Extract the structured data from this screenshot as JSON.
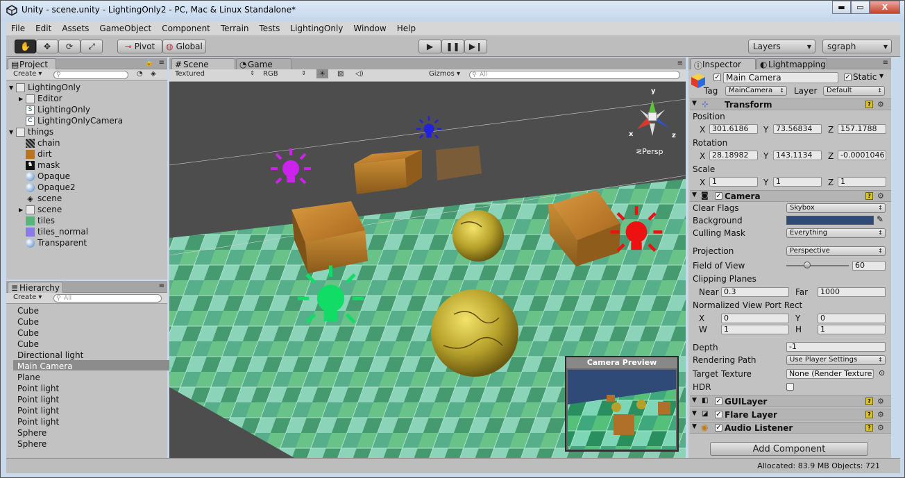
{
  "window": {
    "title": "Unity - scene.unity - LightingOnly2 - PC, Mac & Linux Standalone*",
    "minimize": "▬",
    "maximize": "▭",
    "close": "X"
  },
  "menu": [
    "File",
    "Edit",
    "Assets",
    "GameObject",
    "Component",
    "Terrain",
    "Tests",
    "LightingOnly",
    "Window",
    "Help"
  ],
  "toolbar": {
    "pivot": "Pivot",
    "global": "Global",
    "layers": "Layers",
    "layout": "sgraph"
  },
  "project": {
    "tab": "Project",
    "create": "Create",
    "items": [
      {
        "label": "LightingOnly",
        "icon": "folder-icon"
      },
      {
        "label": "Editor",
        "icon": "folder-icon"
      },
      {
        "label": "LightingOnly",
        "icon": "script-icon"
      },
      {
        "label": "LightingOnlyCamera",
        "icon": "script-icon"
      },
      {
        "label": "things",
        "icon": "folder-icon"
      },
      {
        "label": "chain",
        "icon": "texture-icon"
      },
      {
        "label": "dirt",
        "icon": "texture-icon"
      },
      {
        "label": "mask",
        "icon": "texture-icon"
      },
      {
        "label": "Opaque",
        "icon": "material-icon"
      },
      {
        "label": "Opaque2",
        "icon": "material-icon"
      },
      {
        "label": "scene",
        "icon": "unity-scene-icon"
      },
      {
        "label": "scene",
        "icon": "folder-icon"
      },
      {
        "label": "tiles",
        "icon": "texture-icon"
      },
      {
        "label": "tiles_normal",
        "icon": "texture-icon"
      },
      {
        "label": "Transparent",
        "icon": "material-icon"
      }
    ]
  },
  "hierarchy": {
    "tab": "Hierarchy",
    "create": "Create",
    "search_placeholder": "All",
    "items": [
      "Cube",
      "Cube",
      "Cube",
      "Cube",
      "Directional light",
      "Main Camera",
      "Plane",
      "Point light",
      "Point light",
      "Point light",
      "Point light",
      "Sphere",
      "Sphere"
    ],
    "selected": "Main Camera"
  },
  "scene": {
    "tabs": [
      "Scene",
      "Game"
    ],
    "draw_mode": "Textured",
    "channel": "RGB",
    "gizmos": "Gizmos",
    "search_placeholder": "All",
    "persp_label": "Persp",
    "axis_x": "x",
    "axis_y": "y",
    "axis_z": "z",
    "camera_preview_title": "Camera Preview",
    "light_colors": {
      "purple": "#cc22ee",
      "blue": "#2222dd",
      "green": "#11dd66",
      "red": "#ee1111"
    }
  },
  "inspector": {
    "tabs": [
      "Inspector",
      "Lightmapping"
    ],
    "object_name": "Main Camera",
    "static": "Static",
    "tag_label": "Tag",
    "tag": "MainCamera",
    "layer_label": "Layer",
    "layer": "Default",
    "transform": {
      "title": "Transform",
      "position_label": "Position",
      "rotation_label": "Rotation",
      "scale_label": "Scale",
      "x": "X",
      "y": "Y",
      "z": "Z",
      "position": [
        "301.6186",
        "73.56834",
        "157.1788"
      ],
      "rotation": [
        "28.18982",
        "143.1134",
        "-0.0001046"
      ],
      "scale": [
        "1",
        "1",
        "1"
      ]
    },
    "camera": {
      "title": "Camera",
      "clear_flags_label": "Clear Flags",
      "clear_flags": "Skybox",
      "background_label": "Background",
      "background_color": "#304a78",
      "culling_mask_label": "Culling Mask",
      "culling_mask": "Everything",
      "projection_label": "Projection",
      "projection": "Perspective",
      "fov_label": "Field of View",
      "fov": "60",
      "clipping_label": "Clipping Planes",
      "near_label": "Near",
      "near": "0.3",
      "far_label": "Far",
      "far": "1000",
      "viewport_label": "Normalized View Port Rect",
      "vp_x_label": "X",
      "vp_x": "0",
      "vp_y_label": "Y",
      "vp_y": "0",
      "vp_w_label": "W",
      "vp_w": "1",
      "vp_h_label": "H",
      "vp_h": "1",
      "depth_label": "Depth",
      "depth": "-1",
      "rendering_path_label": "Rendering Path",
      "rendering_path": "Use Player Settings",
      "target_texture_label": "Target Texture",
      "target_texture": "None (Render Texture)",
      "hdr_label": "HDR"
    },
    "components": [
      "GUILayer",
      "Flare Layer",
      "Audio Listener"
    ],
    "add_component": "Add Component"
  },
  "status": "Allocated: 83.9 MB Objects: 721"
}
